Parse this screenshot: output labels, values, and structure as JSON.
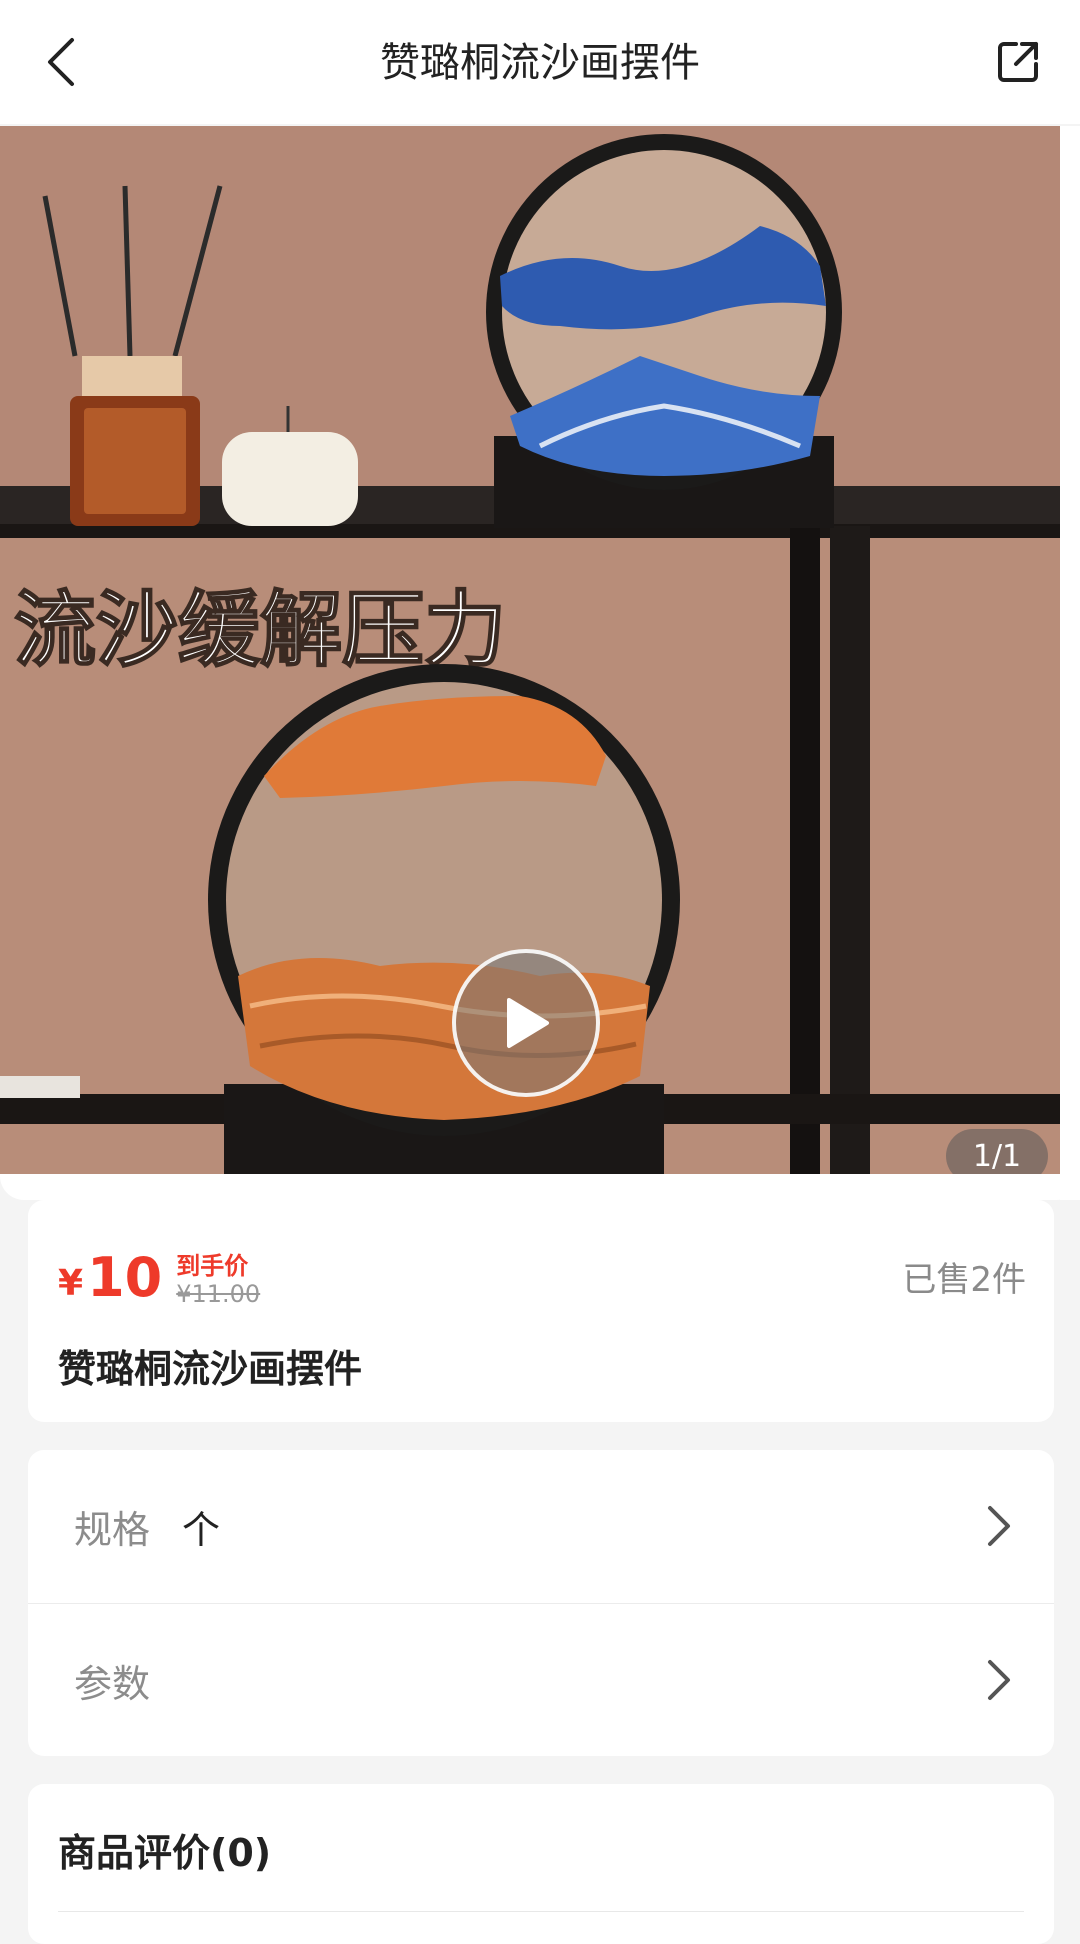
{
  "header": {
    "title": "赞璐桐流沙画摆件",
    "back_icon": "back-arrow-icon",
    "share_icon": "share-external-icon"
  },
  "gallery": {
    "overlay_text": "流沙缓解压力",
    "counter": "1/1",
    "play_icon": "play-icon"
  },
  "price": {
    "currency": "¥",
    "amount": "10",
    "label": "到手价",
    "original": "¥11.00",
    "sold": "已售2件",
    "accent_color": "#ee3a2a"
  },
  "product": {
    "name": "赞璐桐流沙画摆件"
  },
  "specs": {
    "items": [
      {
        "label": "规格",
        "value": "个"
      },
      {
        "label": "参数",
        "value": ""
      }
    ]
  },
  "reviews": {
    "title": "商品评价(0)"
  }
}
